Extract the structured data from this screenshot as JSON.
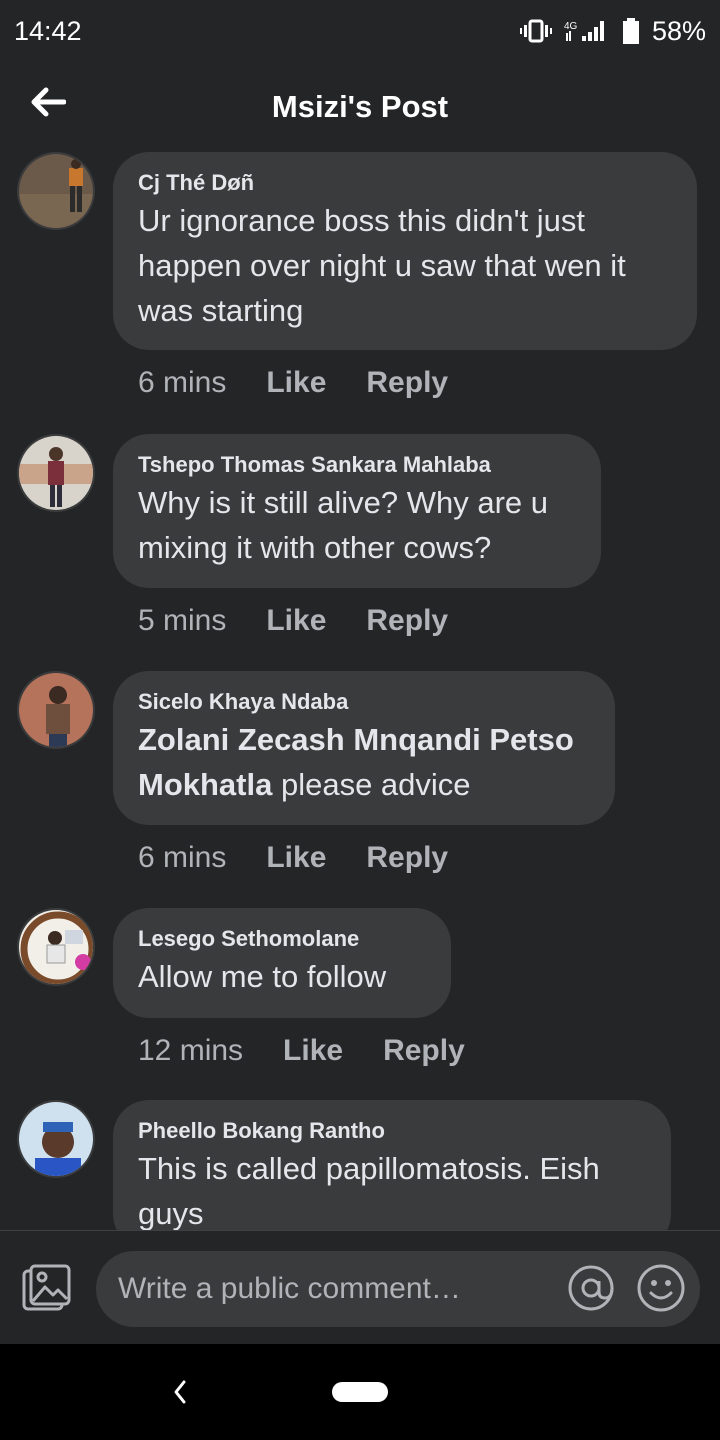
{
  "status_bar": {
    "time": "14:42",
    "network": "4G",
    "battery": "58%",
    "icons": [
      "vibrate-icon",
      "signal-icon",
      "battery-icon"
    ]
  },
  "header": {
    "title": "Msizi's Post",
    "back_icon": "back-arrow-icon"
  },
  "comments": [
    {
      "author": "Cj Thé Døñ",
      "text": "Ur ignorance boss this didn't just happen over night u saw that wen it was starting",
      "time": "6 mins",
      "like_label": "Like",
      "reply_label": "Reply"
    },
    {
      "author": "Tshepo Thomas Sankara Mahlaba",
      "text": "Why is it still alive? Why are u mixing it with other cows?",
      "time": "5 mins",
      "like_label": "Like",
      "reply_label": "Reply"
    },
    {
      "author": "Sicelo Khaya Ndaba",
      "mention": "Zolani Zecash Mnqandi Petso Mokhatla",
      "text": " please advice",
      "time": "6 mins",
      "like_label": "Like",
      "reply_label": "Reply"
    },
    {
      "author": "Lesego Sethomolane",
      "text": "Allow me to follow",
      "time": "12 mins",
      "like_label": "Like",
      "reply_label": "Reply"
    },
    {
      "author": "Pheello Bokang Rantho",
      "text": "This is called papillomatosis. Eish guys"
    }
  ],
  "composer": {
    "placeholder": "Write a public comment…",
    "icons": [
      "gallery-icon",
      "mention-icon",
      "emoji-icon"
    ]
  },
  "colors": {
    "background": "#242527",
    "bubble": "#3a3b3c",
    "text_primary": "#e4e6eb",
    "text_secondary": "#b0b3b8"
  }
}
